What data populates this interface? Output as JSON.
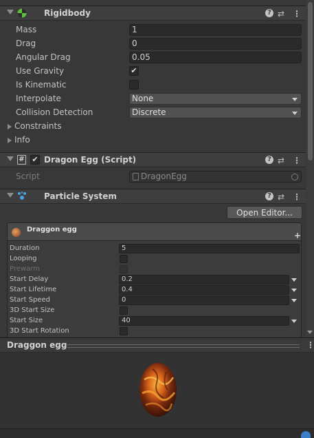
{
  "rigidbody": {
    "title": "Rigidbody",
    "properties": [
      {
        "label": "Mass",
        "value": "1"
      },
      {
        "label": "Drag",
        "value": "0"
      },
      {
        "label": "Angular Drag",
        "value": "0.05"
      }
    ],
    "use_gravity": {
      "label": "Use Gravity",
      "checked": true,
      "mark": "✔"
    },
    "is_kinematic": {
      "label": "Is Kinematic",
      "checked": false
    },
    "interpolate": {
      "label": "Interpolate",
      "value": "None"
    },
    "collision_detection": {
      "label": "Collision Detection",
      "value": "Discrete"
    },
    "constraints_label": "Constraints",
    "info_label": "Info"
  },
  "script_component": {
    "title": "Dragon Egg (Script)",
    "script_label": "Script",
    "script_value": "DragonEgg",
    "hash_glyph": "#",
    "enabled_mark": "✔"
  },
  "particle_system": {
    "title": "Particle System",
    "open_editor_label": "Open Editor...",
    "module_title": "Draggon egg",
    "plus_glyph": "+",
    "rows": {
      "duration": {
        "label": "Duration",
        "value": "5"
      },
      "looping": {
        "label": "Looping"
      },
      "prewarm": {
        "label": "Prewarm"
      },
      "start_delay": {
        "label": "Start Delay",
        "value": "0.2"
      },
      "start_lifetime": {
        "label": "Start Lifetime",
        "value": "0.4"
      },
      "start_speed": {
        "label": "Start Speed",
        "value": "0"
      },
      "start_size_3d": {
        "label": "3D Start Size"
      },
      "start_size": {
        "label": "Start Size",
        "value": "40"
      },
      "start_rotation_3d": {
        "label": "3D Start Rotation"
      }
    }
  },
  "preview": {
    "title": "Draggon egg"
  },
  "icons": {
    "help": "?",
    "presets": "⇄",
    "menu": "⋮"
  },
  "colors": {
    "panel_bg": "#383838",
    "header_bg": "#3e3e3e",
    "field_bg": "#2a2a2a",
    "accent_blue": "#4aa3df",
    "egg_orange": "#d8641a"
  }
}
